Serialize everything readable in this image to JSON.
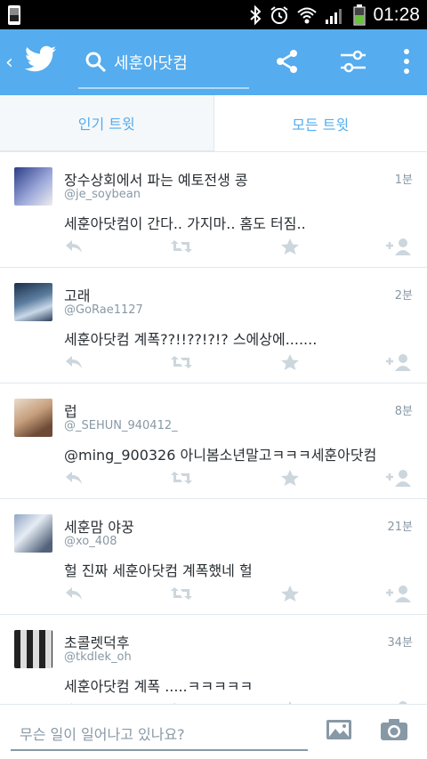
{
  "status": {
    "time": "01:28"
  },
  "appbar": {
    "query": "세훈아닷컴",
    "back_icon": "chevron-left-icon",
    "logo": "twitter-bird-icon",
    "icons": [
      "share-icon",
      "filter-icon",
      "overflow-menu-icon"
    ]
  },
  "tabs": [
    "인기 트윗",
    "모든 트윗"
  ],
  "tweets": [
    {
      "name": "장수상회에서 파는 예토전생 콩",
      "handle": "@je_soybean",
      "time": "1분",
      "text": "세훈아닷컴이 간다.. 가지마.. 홈도 터짐..",
      "avatar_color": "#6b7ab7"
    },
    {
      "name": "고래",
      "handle": "@GoRae1127",
      "time": "2분",
      "text": "세훈아닷컴 계폭??!!??!?!? 스에상에.......",
      "avatar_color": "#2b4a6a"
    },
    {
      "name": "럽",
      "handle": "@_SEHUN_940412_",
      "time": "8분",
      "text": "@ming_900326 아니봄소년말고ㅋㅋㅋ세훈아닷컴",
      "avatar_color": "#c9b39a"
    },
    {
      "name": "세훈맘 야꿍",
      "handle": "@xo_408",
      "time": "21분",
      "text": "헐 진짜 세훈아닷컴 계폭했네 헐",
      "avatar_color": "#9bb0c9"
    },
    {
      "name": "초콜렛덕후",
      "handle": "@tkdlek_oh",
      "time": "34분",
      "text": "세훈아닷컴 계폭 .....ㅋㅋㅋㅋㅋ",
      "avatar_color": "#444"
    }
  ],
  "compose": {
    "placeholder": "무슨 일이 일어나고 있나요?"
  },
  "colors": {
    "brand": "#55acee",
    "muted": "#8899a6",
    "text": "#292f33"
  }
}
